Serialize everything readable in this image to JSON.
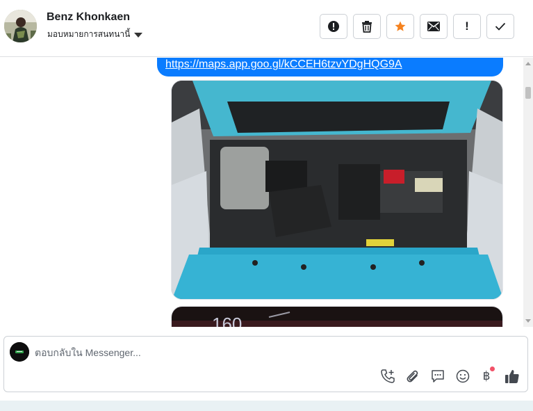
{
  "header": {
    "contact_name": "Benz Khonkaen",
    "assign_label": "มอบหมายการสนทนานี้",
    "buttons": [
      {
        "name": "mark-important-button",
        "icon": "alert-circle-icon"
      },
      {
        "name": "delete-button",
        "icon": "trash-icon"
      },
      {
        "name": "star-button",
        "icon": "star-icon",
        "color": "#f5821f"
      },
      {
        "name": "mark-unread-button",
        "icon": "envelope-icon"
      },
      {
        "name": "flag-button",
        "icon": "exclamation-icon",
        "label": "!"
      },
      {
        "name": "done-button",
        "icon": "checkmark-icon"
      }
    ]
  },
  "messages": {
    "link_text": "https://maps.app.goo.gl/kCCEH6tzvYDgHQG9A",
    "bubble_color": "#0a7cff"
  },
  "composer": {
    "placeholder": "ตอบกลับใน Messenger...",
    "tools": [
      "phone-add-icon",
      "paperclip-icon",
      "speech-bubble-icon",
      "smiley-icon",
      "baht-icon",
      "thumbs-up-icon"
    ],
    "baht_symbol": "฿"
  }
}
